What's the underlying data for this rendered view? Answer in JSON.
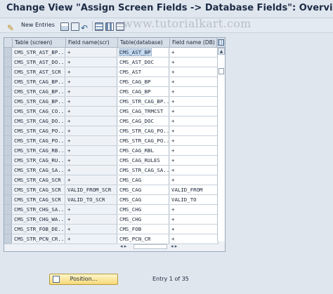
{
  "window": {
    "title": "Change View \"Assign Screen Fields -> Database Fields\": Overview"
  },
  "toolbar": {
    "new_entries_label": "New Entries",
    "icons": [
      "pencil-glasses-icon",
      "copy-icon",
      "delete-icon",
      "undo-icon",
      "select-block-icon",
      "deselect-all-icon",
      "select-all-icon"
    ]
  },
  "watermark": "www.tutorialkart.com",
  "table": {
    "columns": [
      "Table (screen)",
      "Field name(scr)",
      "Table(database)",
      "Field name (DB)"
    ],
    "rows": [
      [
        "CMS_STR_AST_BP...",
        "+",
        "CMS_AST_BP",
        "+"
      ],
      [
        "CMS_STR_AST_DO...",
        "+",
        "CMS_AST_DOC",
        "+"
      ],
      [
        "CMS_STR_AST_SCR",
        "+",
        "CMS_AST",
        "+"
      ],
      [
        "CMS_STR_CAG_BP...",
        "+",
        "CMS_CAG_BP",
        "+"
      ],
      [
        "CMS_STR_CAG_BP...",
        "+",
        "CMS_CAG_BP",
        "+"
      ],
      [
        "CMS_STR_CAG_BP...",
        "+",
        "CMS_STR_CAG_BP...",
        "+"
      ],
      [
        "CMS_STR_CAG_CO...",
        "+",
        "CMS_CAG_TRMCST",
        "+"
      ],
      [
        "CMS_STR_CAG_DO...",
        "+",
        "CMS_CAG_DOC",
        "+"
      ],
      [
        "CMS_STR_CAG_PO...",
        "+",
        "CMS_STR_CAG_PO...",
        "+"
      ],
      [
        "CMS_STR_CAG_PO...",
        "+",
        "CMS_STR_CAG_PO...",
        "+"
      ],
      [
        "CMS_STR_CAG_RB...",
        "+",
        "CMS_CAG_RBL",
        "+"
      ],
      [
        "CMS_STR_CAG_RU...",
        "+",
        "CMS_CAG_RULES",
        "+"
      ],
      [
        "CMS_STR_CAG_SA...",
        "+",
        "CMS_STR_CAG_SA...",
        "+"
      ],
      [
        "CMS_STR_CAG_SCR",
        "+",
        "CMS_CAG",
        "+"
      ],
      [
        "CMS_STR_CAG_SCR",
        "VALID_FROM_SCR",
        "CMS_CAG",
        "VALID_FROM"
      ],
      [
        "CMS_STR_CAG_SCR",
        "VALID_TO_SCR",
        "CMS_CAG",
        "VALID_TO"
      ],
      [
        "CMS_STR_CHG_SA...",
        "+",
        "CMS_CHG",
        "+"
      ],
      [
        "CMS_STR_CHG_WA...",
        "+",
        "CMS_CHG",
        "+"
      ],
      [
        "CMS_STR_FOB_DE...",
        "+",
        "CMS_FOB",
        "+"
      ],
      [
        "CMS_STR_PCN_CR...",
        "+",
        "CMS_PCN_CR",
        "+"
      ]
    ]
  },
  "footer": {
    "position_button": "Position...",
    "entry_info": "Entry 1 of 35"
  }
}
